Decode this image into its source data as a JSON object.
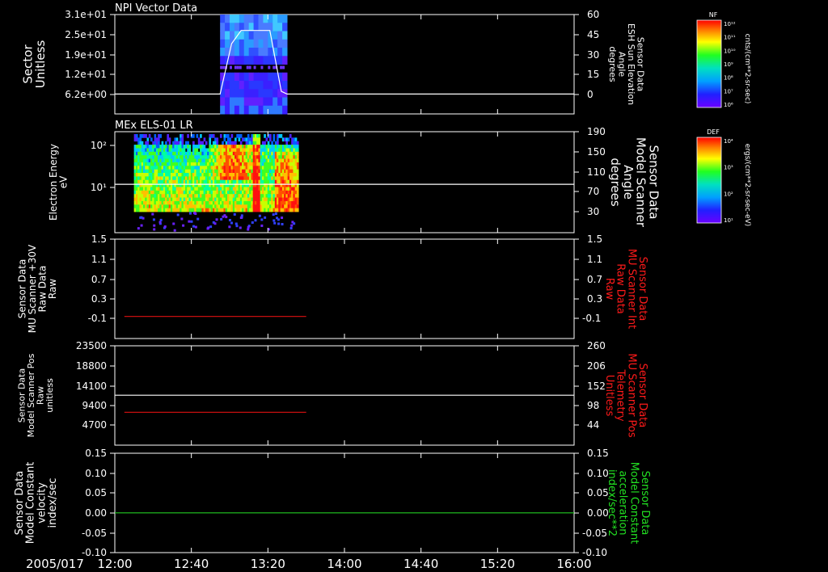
{
  "colors": {
    "background": "#000000",
    "axis": "#ffffff",
    "red_label": "#ff1a1a",
    "green_label": "#22e022"
  },
  "time_axis": {
    "date_label": "2005/017",
    "tick_labels": [
      "12:00",
      "12:40",
      "13:20",
      "14:00",
      "14:40",
      "15:20",
      "16:00"
    ]
  },
  "chart_data": [
    {
      "type": "heatmap",
      "title": "NPI Vector Data",
      "ylabel": [
        "Sector",
        "Unitless"
      ],
      "yticks": [
        "3.1e+01",
        "2.5e+01",
        "1.9e+01",
        "1.2e+01",
        "6.2e+00"
      ],
      "x_extent": [
        "12:00",
        "16:00"
      ],
      "spectrogram_extent": [
        "12:55",
        "13:30"
      ],
      "overlay": {
        "type": "line",
        "name_lines": [
          "Sensor Data",
          "ESH Sun Elevation",
          "Angle",
          "degrees"
        ],
        "color": "#ffffff",
        "right_ylim": [
          -15,
          60
        ],
        "right_yticks": [
          "60",
          "45",
          "30",
          "15",
          "0"
        ],
        "points": [
          [
            "12:00",
            0
          ],
          [
            "12:55",
            0
          ],
          [
            "13:01",
            38
          ],
          [
            "13:06",
            48
          ],
          [
            "13:21",
            48
          ],
          [
            "13:27",
            2
          ],
          [
            "13:30",
            0
          ],
          [
            "16:00",
            0
          ]
        ]
      },
      "colorbar": {
        "label": "NF",
        "units": "cnts/(cm**2-sr-sec)",
        "ticks": [
          "10¹²",
          "10¹¹",
          "10¹⁰",
          "10⁹",
          "10⁸",
          "10⁷",
          "10⁶"
        ]
      }
    },
    {
      "type": "heatmap",
      "title": "MEx ELS-01 LR",
      "ylabel": [
        "Electron Energy",
        "eV"
      ],
      "yticks": [
        "10²",
        "10¹"
      ],
      "x_extent": [
        "12:00",
        "16:00"
      ],
      "spectrogram_extent": [
        "12:10",
        "13:36"
      ],
      "overlay": {
        "type": "line",
        "name_lines": [
          "Sensor Data",
          "Model Scanner",
          "Angle",
          "degrees"
        ],
        "color": "#ffffff",
        "right_ylim": [
          0,
          190
        ],
        "right_yticks": [
          "190",
          "150",
          "110",
          "70",
          "30"
        ],
        "points": [
          [
            "12:00",
            91
          ],
          [
            "16:00",
            91
          ]
        ]
      },
      "colorbar": {
        "label": "DEF",
        "units": "ergs/(cm**2-sr-sec-eV)",
        "ticks": [
          "10⁴",
          "10³",
          "10²",
          "10¹"
        ]
      }
    },
    {
      "type": "line",
      "ylabel": [
        "Sensor Data",
        "MU Scanner +30V",
        "Raw Data",
        "Raw"
      ],
      "ylim": [
        -0.3,
        1.5
      ],
      "yticks": [
        "1.5",
        "1.1",
        "0.7",
        "0.3",
        "-0.1"
      ],
      "right_ylabel": [
        "Sensor Data",
        "MU Scanner Int",
        "Raw Data",
        "Raw"
      ],
      "right_ylabel_color": "#ff1a1a",
      "right_ylim": [
        -0.3,
        1.5
      ],
      "right_yticks": [
        "1.5",
        "1.1",
        "0.7",
        "0.3",
        "-0.1"
      ],
      "series": [
        {
          "color": "#dd1111",
          "points": [
            [
              "12:05",
              0.1
            ],
            [
              "13:40",
              0.1
            ]
          ]
        }
      ]
    },
    {
      "type": "line",
      "ylabel": [
        "Sensor Data",
        "Model Scanner Pos",
        "Raw",
        "unitless"
      ],
      "ylim": [
        0,
        23500
      ],
      "yticks": [
        "23500",
        "18800",
        "14100",
        "9400",
        "4700"
      ],
      "right_ylabel": [
        "Sensor Data",
        "MU Scanner Pos",
        "Telemetry",
        "Unitless"
      ],
      "right_ylabel_color": "#ff1a1a",
      "right_ylim": [
        0,
        260
      ],
      "right_yticks": [
        "260",
        "206",
        "152",
        "98",
        "44"
      ],
      "series": [
        {
          "color": "#ffffff",
          "axis": "left",
          "points": [
            [
              "12:00",
              11800
            ],
            [
              "16:00",
              11800
            ]
          ]
        },
        {
          "color": "#dd1111",
          "axis": "right",
          "points": [
            [
              "12:05",
              86
            ],
            [
              "13:40",
              86
            ]
          ]
        }
      ]
    },
    {
      "type": "line",
      "ylabel": [
        "Sensor Data",
        "Model Constant",
        "velocity",
        "index/sec"
      ],
      "ylim": [
        -0.1,
        0.15
      ],
      "yticks": [
        "0.15",
        "0.10",
        "0.05",
        "0.00",
        "-0.05",
        "-0.10"
      ],
      "right_ylabel": [
        "Sensor Data",
        "Model Constant",
        "acceleration",
        "index/sec**2"
      ],
      "right_ylabel_color": "#22e022",
      "right_ylim": [
        -0.1,
        0.15
      ],
      "right_yticks": [
        "0.15",
        "0.10",
        "0.05",
        "0.00",
        "-0.05",
        "-0.10"
      ],
      "series": [
        {
          "color": "#22cc22",
          "points": [
            [
              "12:00",
              0.0
            ],
            [
              "16:00",
              0.0
            ]
          ]
        }
      ]
    }
  ]
}
